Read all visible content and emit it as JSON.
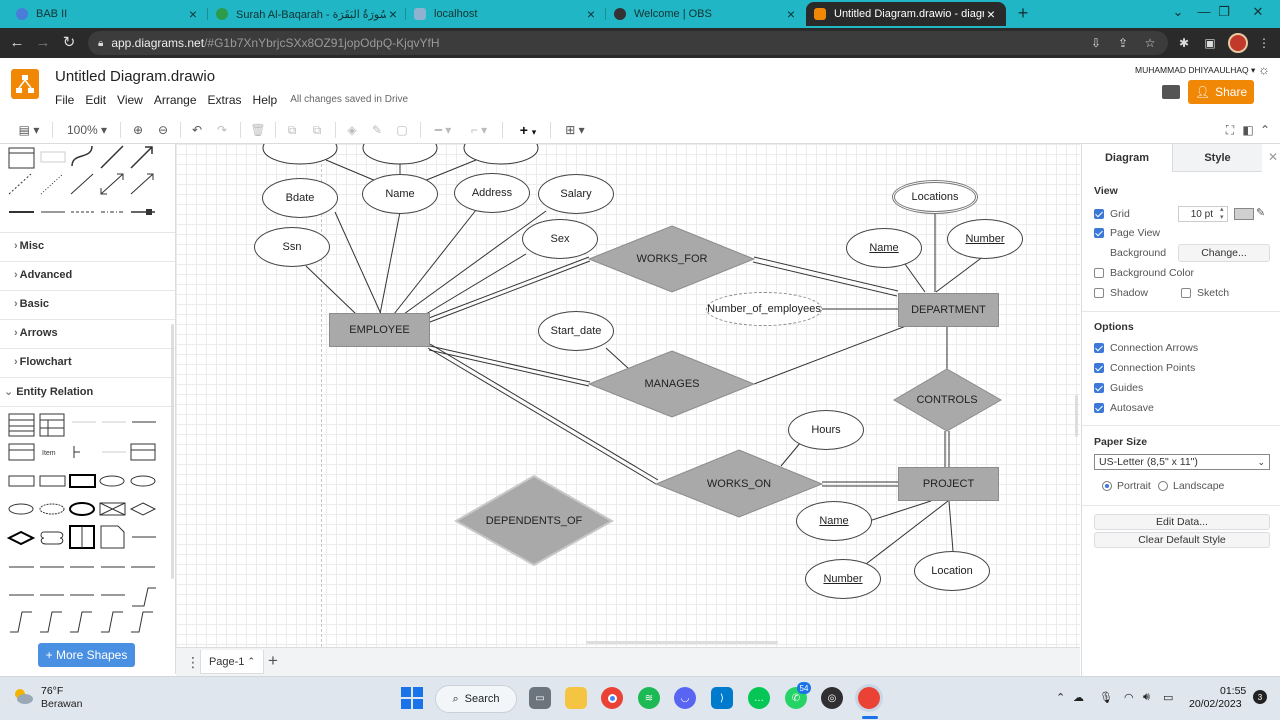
{
  "browser": {
    "tabs": [
      {
        "label": "BAB II",
        "color": "#4a7dd8"
      },
      {
        "label": "Surah Al-Baqarah - سُورَةُ البَقَرَة |",
        "color": "#2c9c4a"
      },
      {
        "label": "localhost",
        "color": "#8fb2d0"
      },
      {
        "label": "Welcome | OBS",
        "color": "#333333"
      },
      {
        "label": "Untitled Diagram.drawio - diagra",
        "color": "#f08705"
      }
    ],
    "url_host": "app.diagrams.net",
    "url_path": "/#G1b7XnYbrjcSXx8OZ91jopOdpQ-KjqvYfH"
  },
  "app": {
    "title": "Untitled Diagram.drawio",
    "menu": [
      "File",
      "Edit",
      "View",
      "Arrange",
      "Extras",
      "Help"
    ],
    "saved_status": "All changes saved in Drive",
    "user": "MUHAMMAD DHIYAAULHAQ",
    "share_label": "Share",
    "zoom": "100%",
    "brand_color": "#f08705"
  },
  "sidebar": {
    "sections": [
      "Misc",
      "Advanced",
      "Basic",
      "Arrows",
      "Flowchart",
      "Entity Relation"
    ],
    "shape_item_label": "Item",
    "more_shapes": "More Shapes"
  },
  "diagram": {
    "entities": {
      "employee": "EMPLOYEE",
      "department": "DEPARTMENT",
      "project": "PROJECT"
    },
    "relationships": {
      "works_for": "WORKS_FOR",
      "manages": "MANAGES",
      "controls": "CONTROLS",
      "works_on": "WORKS_ON",
      "dependents_of": "DEPENDENTS_OF"
    },
    "attributes": {
      "bdate": "Bdate",
      "name": "Name",
      "address": "Address",
      "salary": "Salary",
      "ssn": "Ssn",
      "sex": "Sex",
      "start_date": "Start_date",
      "locations": "Locations",
      "dept_name": "Name",
      "dept_number": "Number",
      "number_of_employees": "Number_of_employees",
      "hours": "Hours",
      "proj_name": "Name",
      "proj_number": "Number",
      "location": "Location"
    }
  },
  "pages": {
    "current": "Page-1"
  },
  "panel": {
    "tabs": [
      "Diagram",
      "Style"
    ],
    "view_heading": "View",
    "grid": "Grid",
    "grid_size": "10 pt",
    "page_view": "Page View",
    "background": "Background",
    "change": "Change...",
    "background_color": "Background Color",
    "shadow": "Shadow",
    "sketch": "Sketch",
    "options_heading": "Options",
    "connection_arrows": "Connection Arrows",
    "connection_points": "Connection Points",
    "guides": "Guides",
    "autosave": "Autosave",
    "paper_heading": "Paper Size",
    "paper_size": "US-Letter (8,5\" x 11\")",
    "portrait": "Portrait",
    "landscape": "Landscape",
    "edit_data": "Edit Data...",
    "clear_default_style": "Clear Default Style"
  },
  "taskbar": {
    "temp": "76°F",
    "weather": "Berawan",
    "search": "Search",
    "whatsapp_badge": "54",
    "time": "01:55",
    "date": "20/02/2023",
    "notifications": "3"
  }
}
